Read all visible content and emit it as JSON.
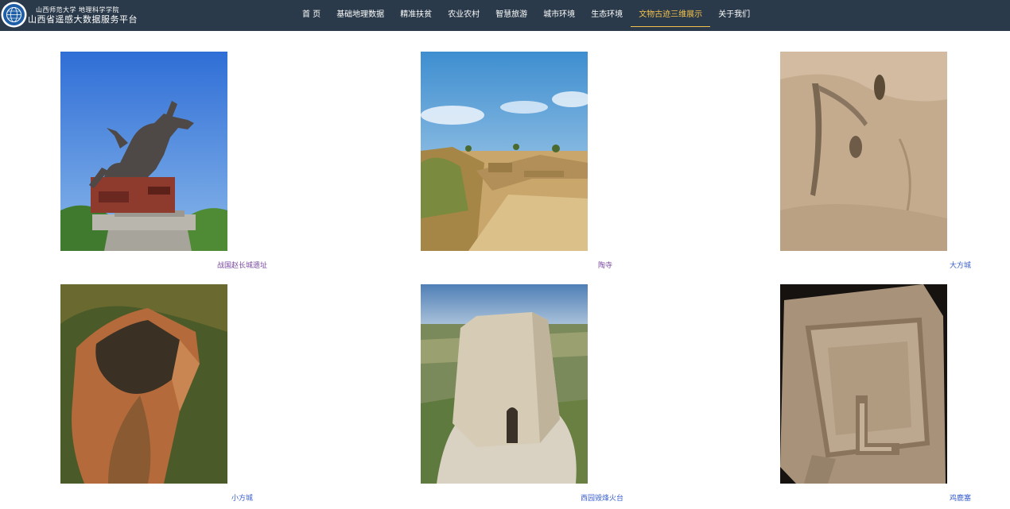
{
  "header": {
    "university": "山西师范大学 地理科学学院",
    "platform": "山西省遥感大数据服务平台"
  },
  "nav": {
    "items": [
      {
        "label": "首 页"
      },
      {
        "label": "基础地理数据"
      },
      {
        "label": "精准扶贫"
      },
      {
        "label": "农业农村"
      },
      {
        "label": "智慧旅游"
      },
      {
        "label": "城市环境"
      },
      {
        "label": "生态环境"
      },
      {
        "label": "文物古迹三维展示",
        "active": true
      },
      {
        "label": "关于我们"
      }
    ]
  },
  "gallery": {
    "items": [
      {
        "caption": "战国赵长城遗址",
        "icon": "statue-photo",
        "caption_color": "#7a4aa0"
      },
      {
        "caption": "陶寺",
        "icon": "ruins-photo",
        "caption_color": "#7a4aa0"
      },
      {
        "caption": "大方城",
        "icon": "desert-photo",
        "caption_color": "#3a5fcd"
      },
      {
        "caption": "小方城",
        "icon": "aerial-fort-photo",
        "caption_color": "#3a5fcd"
      },
      {
        "caption": "西园毁烽火台",
        "icon": "beacon-tower-photo",
        "caption_color": "#3a5fcd"
      },
      {
        "caption": "鸡鹿塞",
        "icon": "fortress-ruins-photo",
        "caption_color": "#3a5fcd"
      }
    ]
  },
  "colors": {
    "header_bg": "#2a3a4a",
    "active_nav": "#f2c14e"
  }
}
